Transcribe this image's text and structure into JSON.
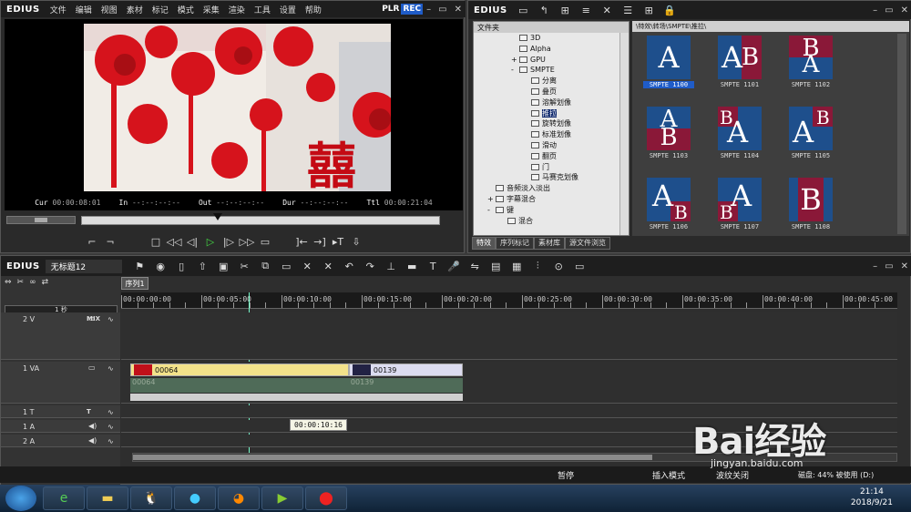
{
  "player": {
    "logo": "EDIUS",
    "menu": [
      "文件",
      "编辑",
      "视图",
      "素材",
      "标记",
      "模式",
      "采集",
      "渲染",
      "工具",
      "设置",
      "帮助"
    ],
    "plr": "PLR",
    "rec": "REC",
    "timecodes": {
      "cur_label": "Cur",
      "cur": "00:00:08:01",
      "in_label": "In",
      "in": "--:--:--:--",
      "out_label": "Out",
      "out": "--:--:--:--",
      "dur_label": "Dur",
      "dur": "--:--:--:--",
      "ttl_label": "Ttl",
      "ttl": "00:00:21:04"
    },
    "playhead_fraction": 0.38
  },
  "bin": {
    "logo": "EDIUS",
    "tree_header": "文件夹",
    "tree_items": [
      {
        "label": "3D",
        "indent": 3,
        "expander": "",
        "type": "fx"
      },
      {
        "label": "Alpha",
        "indent": 3,
        "expander": "",
        "type": "fx"
      },
      {
        "label": "GPU",
        "indent": 3,
        "expander": "+",
        "type": "fx"
      },
      {
        "label": "SMPTE",
        "indent": 3,
        "expander": "-",
        "type": "folder"
      },
      {
        "label": "分离",
        "indent": 4,
        "expander": "",
        "type": "fx"
      },
      {
        "label": "叠页",
        "indent": 4,
        "expander": "",
        "type": "fx"
      },
      {
        "label": "溶解划像",
        "indent": 4,
        "expander": "",
        "type": "fx"
      },
      {
        "label": "推拉",
        "indent": 4,
        "expander": "",
        "type": "fx",
        "selected": true
      },
      {
        "label": "旋转划像",
        "indent": 4,
        "expander": "",
        "type": "fx"
      },
      {
        "label": "标准划像",
        "indent": 4,
        "expander": "",
        "type": "fx"
      },
      {
        "label": "滑动",
        "indent": 4,
        "expander": "",
        "type": "fx"
      },
      {
        "label": "翻页",
        "indent": 4,
        "expander": "",
        "type": "fx"
      },
      {
        "label": "门",
        "indent": 4,
        "expander": "",
        "type": "fx"
      },
      {
        "label": "马赛克划像",
        "indent": 4,
        "expander": "",
        "type": "fx"
      },
      {
        "label": "音频淡入淡出",
        "indent": 1,
        "expander": "",
        "type": "fx"
      },
      {
        "label": "字幕混合",
        "indent": 1,
        "expander": "+",
        "type": "fx"
      },
      {
        "label": "键",
        "indent": 1,
        "expander": "-",
        "type": "folder"
      },
      {
        "label": "混合",
        "indent": 2,
        "expander": "",
        "type": "fx"
      }
    ],
    "path": "\\特效\\转场\\SMPTE\\推拉\\",
    "tiles": [
      {
        "label": "SMPTE 1100",
        "style": "A",
        "selected": true
      },
      {
        "label": "SMPTE 1101",
        "style": "AB-v"
      },
      {
        "label": "SMPTE 1102",
        "style": "BA-h"
      },
      {
        "label": "SMPTE 1103",
        "style": "AB-h2"
      },
      {
        "label": "SMPTE 1104",
        "style": "BA-c"
      },
      {
        "label": "SMPTE 1105",
        "style": "AB-c"
      },
      {
        "label": "SMPTE 1106",
        "style": "AB-br"
      },
      {
        "label": "SMPTE 1107",
        "style": "AB-bl"
      },
      {
        "label": "SMPTE 1108",
        "style": "B"
      }
    ],
    "tabs": [
      "特效",
      "序列标记",
      "素材库",
      "源文件浏览"
    ]
  },
  "timeline": {
    "logo": "EDIUS",
    "project": "无标题12",
    "sequence_tab": "序列1",
    "zoom": "1 秒",
    "ruler": [
      "00:00:00:00",
      "00:00:05:00",
      "00:00:10:00",
      "00:00:15:00",
      "00:00:20:00",
      "00:00:25:00",
      "00:00:30:00",
      "00:00:35:00",
      "00:00:40:00",
      "00:00:45:00"
    ],
    "tracks": [
      {
        "name": "2 V",
        "extra": "MIX"
      },
      {
        "name": "1 VA",
        "extra": ""
      },
      {
        "name": "1 T",
        "extra": "T"
      },
      {
        "name": "1 A",
        "extra": ""
      },
      {
        "name": "2 A",
        "extra": ""
      }
    ],
    "clips": [
      {
        "name": "00064",
        "start": 0.4,
        "end": 10.0
      },
      {
        "name": "00139",
        "start": 10.0,
        "end": 15.0
      }
    ],
    "audio_clips": [
      "00064",
      "00139"
    ],
    "tooltip": "00:00:10:16",
    "status": {
      "pause": "暂停",
      "insert_mode": "插入模式",
      "waveform": "波纹关闭",
      "disk": "磁盘: 44% 被使用 (D:)"
    }
  },
  "taskbar": {
    "time": "21:14",
    "date": "2018/9/21"
  },
  "watermark": {
    "text": "Bai经验",
    "url": "jingyan.baidu.com"
  }
}
